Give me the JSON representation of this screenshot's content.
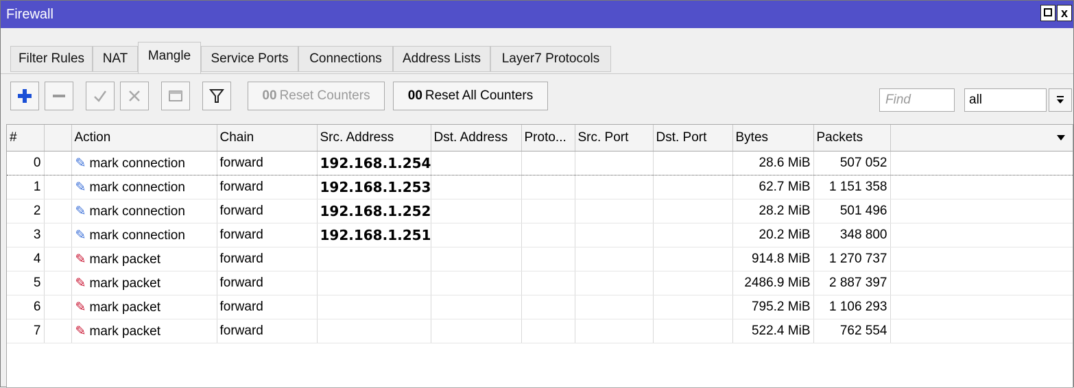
{
  "window": {
    "title": "Firewall",
    "maximize_icon": "maximize-icon",
    "close_label": "x"
  },
  "tabs": [
    {
      "label": "Filter Rules",
      "active": false
    },
    {
      "label": "NAT",
      "active": false
    },
    {
      "label": "Mangle",
      "active": true
    },
    {
      "label": "Service Ports",
      "active": false
    },
    {
      "label": "Connections",
      "active": false
    },
    {
      "label": "Address Lists",
      "active": false
    },
    {
      "label": "Layer7 Protocols",
      "active": false
    }
  ],
  "toolbar": {
    "add_icon": "plus-icon",
    "remove_icon": "minus-icon",
    "enable_icon": "check-icon",
    "disable_icon": "x-icon",
    "comment_icon": "comment-icon",
    "filter_icon": "filter-icon",
    "reset_counters_prefix": "00",
    "reset_counters_label": "Reset Counters",
    "reset_all_prefix": "00",
    "reset_all_label": "Reset All Counters",
    "find_placeholder": "Find",
    "filter_value": "all",
    "dropdown_icon": "dropdown-icon"
  },
  "table": {
    "columns": [
      "#",
      "",
      "Action",
      "Chain",
      "Src. Address",
      "Dst. Address",
      "Proto...",
      "Src. Port",
      "Dst. Port",
      "Bytes",
      "Packets",
      ""
    ],
    "rows": [
      {
        "num": "0",
        "action": "mark connection",
        "action_color": "#3a6fd8",
        "chain": "forward",
        "src": "192.168.1.254",
        "bytes": "28.6 MiB",
        "packets": "507 052"
      },
      {
        "num": "1",
        "action": "mark connection",
        "action_color": "#3a6fd8",
        "chain": "forward",
        "src": "192.168.1.253",
        "bytes": "62.7 MiB",
        "packets": "1 151 358"
      },
      {
        "num": "2",
        "action": "mark connection",
        "action_color": "#3a6fd8",
        "chain": "forward",
        "src": "192.168.1.252",
        "bytes": "28.2 MiB",
        "packets": "501 496"
      },
      {
        "num": "3",
        "action": "mark connection",
        "action_color": "#3a6fd8",
        "chain": "forward",
        "src": "192.168.1.251",
        "bytes": "20.2 MiB",
        "packets": "348 800"
      },
      {
        "num": "4",
        "action": "mark packet",
        "action_color": "#c8102e",
        "chain": "forward",
        "src": "",
        "bytes": "914.8 MiB",
        "packets": "1 270 737"
      },
      {
        "num": "5",
        "action": "mark packet",
        "action_color": "#c8102e",
        "chain": "forward",
        "src": "",
        "bytes": "2486.9 MiB",
        "packets": "2 887 397"
      },
      {
        "num": "6",
        "action": "mark packet",
        "action_color": "#c8102e",
        "chain": "forward",
        "src": "",
        "bytes": "795.2 MiB",
        "packets": "1 106 293"
      },
      {
        "num": "7",
        "action": "mark packet",
        "action_color": "#c8102e",
        "chain": "forward",
        "src": "",
        "bytes": "522.4 MiB",
        "packets": "762 554"
      }
    ]
  }
}
